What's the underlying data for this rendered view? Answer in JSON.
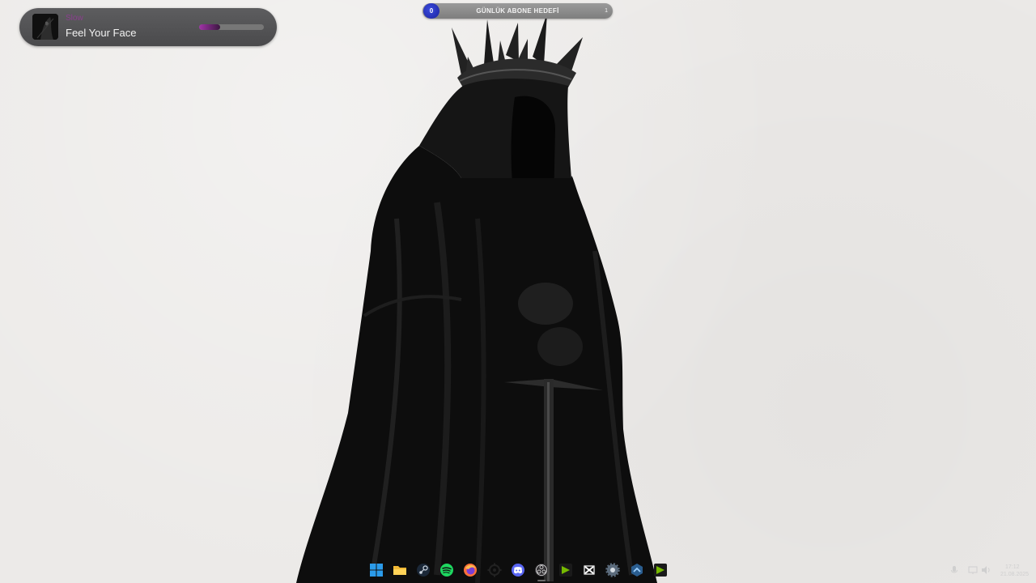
{
  "music_widget": {
    "artist": "Slow",
    "title": "Feel Your Face",
    "progress": 0.33,
    "accent_color": "#a234a8"
  },
  "subscriber_goal": {
    "label": "GÜNLÜK ABONE HEDEFİ",
    "current": "0",
    "target": "1"
  },
  "taskbar": {
    "icons": [
      {
        "name": "windows-start-icon"
      },
      {
        "name": "file-explorer-icon"
      },
      {
        "name": "steam-icon"
      },
      {
        "name": "spotify-icon"
      },
      {
        "name": "firefox-icon"
      },
      {
        "name": "steelseries-gg-icon"
      },
      {
        "name": "discord-icon"
      },
      {
        "name": "obs-studio-icon",
        "active": true
      },
      {
        "name": "nvidia-app-icon"
      },
      {
        "name": "capcut-icon"
      },
      {
        "name": "settings-icon"
      },
      {
        "name": "modrinth-icon"
      },
      {
        "name": "nvidia-app-icon-2"
      }
    ]
  },
  "system_tray": {
    "time": "17:12",
    "date": "21.08.2025"
  },
  "colors": {
    "desktop_background": "#eceae8",
    "widget_background": "#555557",
    "goal_bar": "#8a8a8a",
    "goal_current": "#2a34c4",
    "taskbar_active_indicator": "#6a6a6a"
  }
}
